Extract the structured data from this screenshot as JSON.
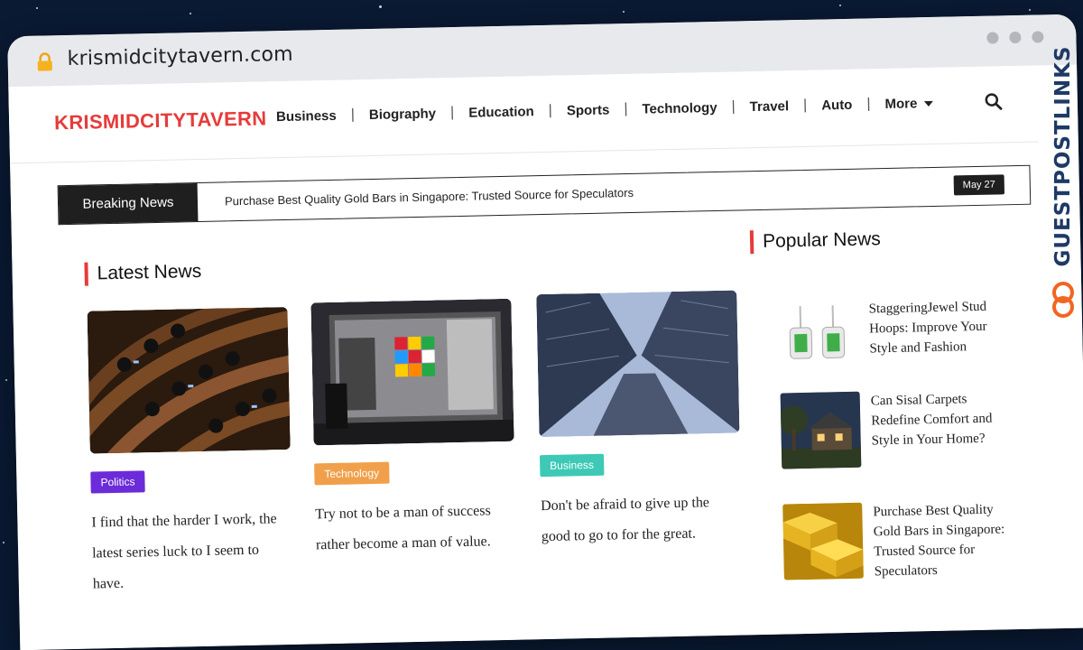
{
  "browser": {
    "url": "krismidcitytavern.com"
  },
  "site": {
    "logo": "KRISMIDCITYTAVERN",
    "nav": [
      "Business",
      "Biography",
      "Education",
      "Sports",
      "Technology",
      "Travel",
      "Auto",
      "More"
    ],
    "separator": "|"
  },
  "ticker": {
    "label": "Breaking News",
    "headline": "Purchase Best Quality Gold Bars in Singapore:  Trusted Source for Speculators",
    "date": "May 27"
  },
  "latest": {
    "title": "Latest News",
    "cards": [
      {
        "category": "Politics",
        "color": "#6c2bd9",
        "text": "I find that the harder I work, the latest series luck to I seem to have."
      },
      {
        "category": "Technology",
        "color": "#f0a04b",
        "text": "Try not to be a man of success rather become a man of value."
      },
      {
        "category": "Business",
        "color": "#3ec9b6",
        "text": "Don't be afraid to give up the good to go to for the great."
      }
    ]
  },
  "popular": {
    "title": "Popular News",
    "items": [
      {
        "text": "StaggeringJewel Stud Hoops: Improve Your Style and Fashion"
      },
      {
        "text": "Can Sisal Carpets Redefine Comfort and Style in Your Home?"
      },
      {
        "text": "Purchase Best Quality Gold Bars in Singapore:  Trusted Source for Speculators"
      }
    ]
  },
  "watermark": "GUESTPOSTLINKS",
  "colors": {
    "accent": "#e63b3b",
    "background": "#0a1a33"
  }
}
